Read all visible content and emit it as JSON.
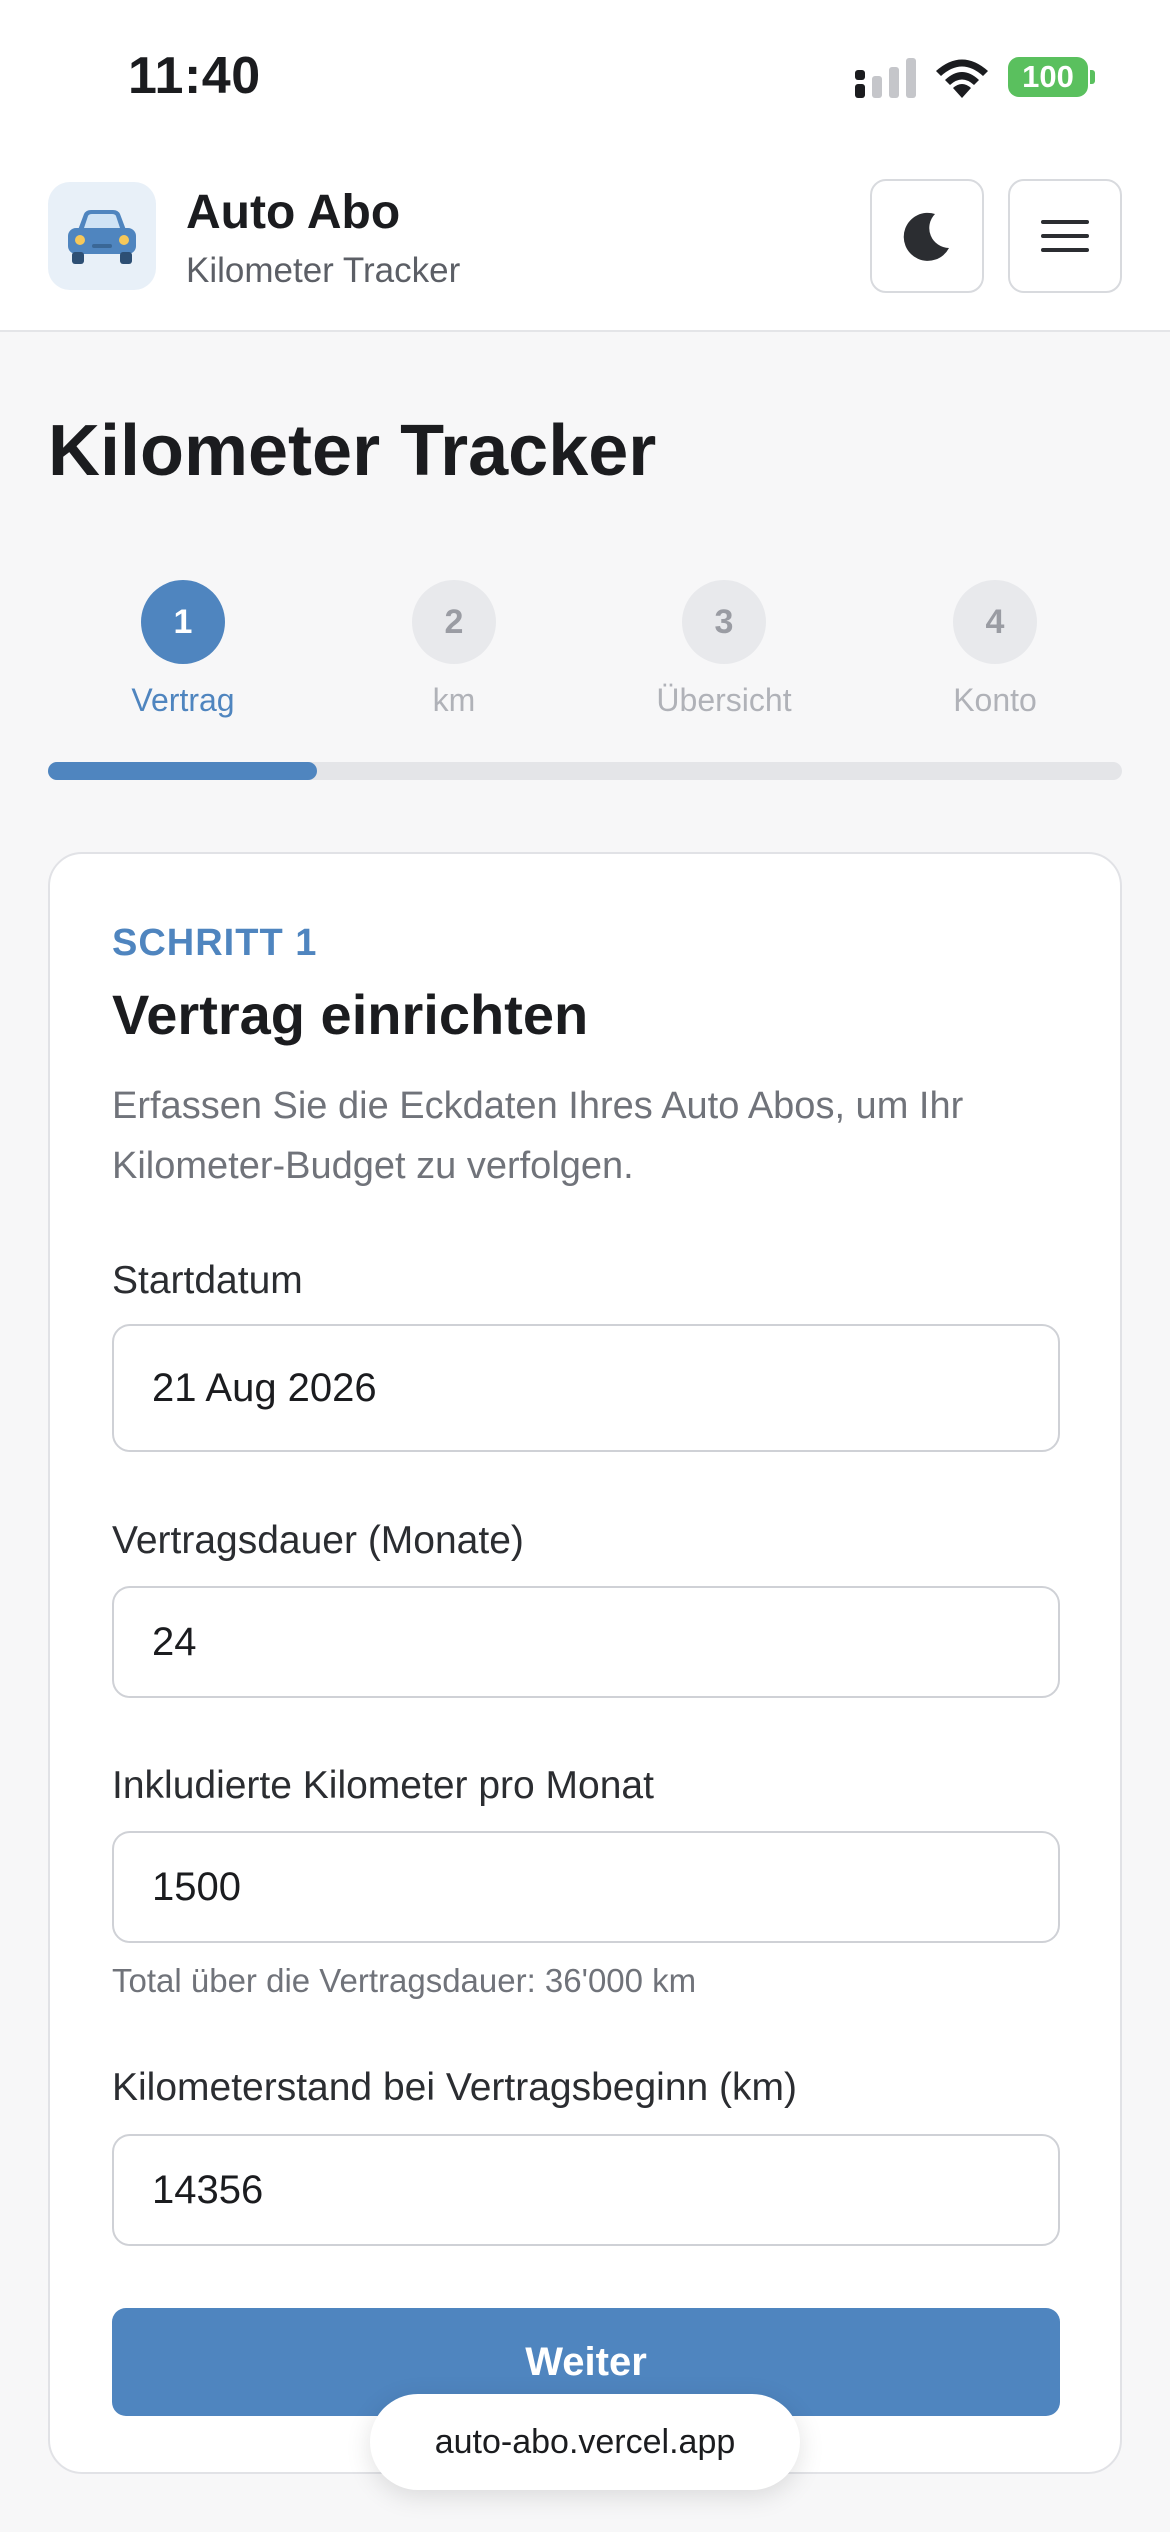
{
  "status_bar": {
    "time": "11:40",
    "battery": "100",
    "signal_icon": "cellular-signal-icon",
    "wifi_icon": "wifi-icon"
  },
  "header": {
    "logo_icon": "car-icon",
    "title": "Auto Abo",
    "subtitle": "Kilometer Tracker",
    "theme_toggle_icon": "moon-icon",
    "menu_icon": "hamburger-menu-icon"
  },
  "page": {
    "title": "Kilometer Tracker"
  },
  "stepper": {
    "steps": [
      {
        "number": "1",
        "label": "Vertrag",
        "active": true
      },
      {
        "number": "2",
        "label": "km",
        "active": false
      },
      {
        "number": "3",
        "label": "Übersicht",
        "active": false
      },
      {
        "number": "4",
        "label": "Konto",
        "active": false
      }
    ],
    "progress_fraction": 0.25
  },
  "form": {
    "step_tag": "SCHRITT 1",
    "title": "Vertrag einrichten",
    "description": "Erfassen Sie die Eckdaten Ihres Auto Abos, um Ihr Kilometer-Budget zu verfolgen.",
    "fields": {
      "start_date": {
        "label": "Startdatum",
        "value": "21 Aug 2026"
      },
      "duration": {
        "label": "Vertragsdauer (Monate)",
        "value": "24"
      },
      "km_per_month": {
        "label": "Inkludierte Kilometer pro Monat",
        "value": "1500",
        "hint": "Total über die Vertragsdauer: 36'000 km"
      },
      "start_odometer": {
        "label": "Kilometerstand bei Vertragsbeginn (km)",
        "value": "14356"
      }
    },
    "next_label": "Weiter"
  },
  "browser": {
    "url": "auto-abo.vercel.app"
  },
  "colors": {
    "accent": "#4f85bf",
    "battery": "#5ac05e"
  }
}
